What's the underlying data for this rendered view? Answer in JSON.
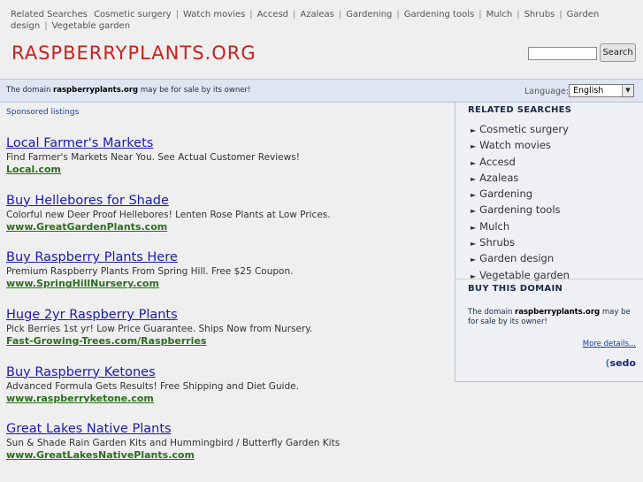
{
  "topbar": {
    "label": "Related Searches",
    "links": [
      "Cosmetic surgery",
      "Watch movies",
      "Accesd",
      "Azaleas",
      "Gardening",
      "Gardening tools",
      "Mulch",
      "Shrubs",
      "Garden design",
      "Vegetable garden"
    ]
  },
  "site_title": "RASPBERRYPLANTS.ORG",
  "search": {
    "value": "",
    "button": "Search"
  },
  "sale_bar": {
    "prefix": "The domain ",
    "domain": "raspberryplants.org",
    "suffix": " may be for sale by its owner!"
  },
  "language": {
    "label": "Language:",
    "selected": "English"
  },
  "sponsored_label": "Sponsored listings",
  "listings": [
    {
      "title": "Local Farmer's Markets",
      "desc": "Find Farmer's Markets Near You. See Actual Customer Reviews!",
      "url": "Local.com"
    },
    {
      "title": "Buy Hellebores for Shade",
      "desc": "Colorful new Deer Proof Hellebores! Lenten Rose Plants at Low Prices.",
      "url": "www.GreatGardenPlants.com"
    },
    {
      "title": "Buy Raspberry Plants Here",
      "desc": "Premium Raspberry Plants From Spring Hill. Free $25 Coupon.",
      "url": "www.SpringHillNursery.com"
    },
    {
      "title": "Huge 2yr Raspberry Plants",
      "desc": "Pick Berries 1st yr! Low Price Guarantee. Ships Now from Nursery.",
      "url": "Fast-Growing-Trees.com/Raspberries"
    },
    {
      "title": "Buy Raspberry Ketones",
      "desc": "Advanced Formula Gets Results! Free Shipping and Diet Guide.",
      "url": "www.raspberryketone.com"
    },
    {
      "title": "Great Lakes Native Plants",
      "desc": "Sun & Shade Rain Garden Kits and Hummingbird / Butterfly Garden Kits",
      "url": "www.GreatLakesNativePlants.com"
    }
  ],
  "sidebar": {
    "related_heading": "RELATED SEARCHES",
    "related": [
      "Cosmetic surgery",
      "Watch movies",
      "Accesd",
      "Azaleas",
      "Gardening",
      "Gardening tools",
      "Mulch",
      "Shrubs",
      "Garden design",
      "Vegetable garden"
    ],
    "buy_heading": "BUY THIS DOMAIN",
    "buy_prefix": "The domain ",
    "buy_domain": "raspberryplants.org",
    "buy_suffix": " may be for sale by its owner!",
    "more": "More details...",
    "sedo": "sedo"
  },
  "colors": {
    "title": "#c8201e",
    "link": "#1a1ab0",
    "url": "#2b6e1e",
    "bar": "#dfe6f1"
  }
}
